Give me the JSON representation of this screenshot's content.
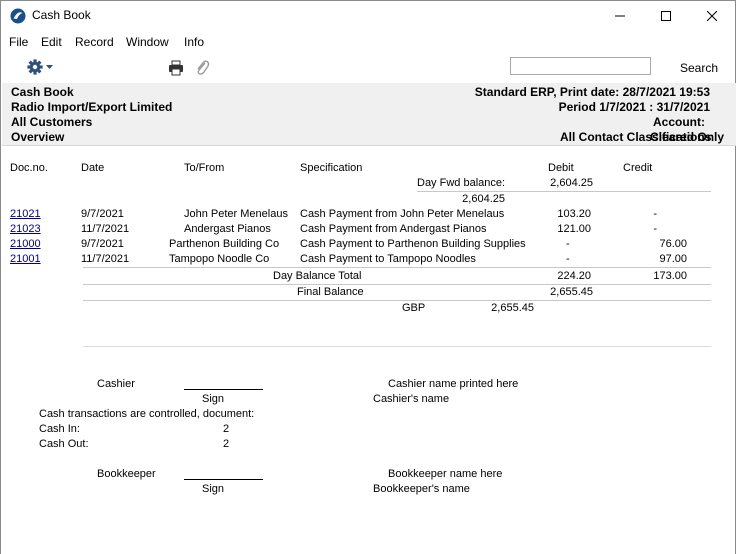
{
  "window": {
    "title": "Cash Book"
  },
  "menu": [
    "File",
    "Edit",
    "Record",
    "Window",
    "Info"
  ],
  "toolbar": {
    "search_value": "",
    "search_label": "Search"
  },
  "header": {
    "report_name": "Cash Book",
    "company": "Radio Import/Export Limited",
    "customers": "All Customers",
    "mode": "Overview",
    "print_info": "Standard ERP, Print date: 28/7/2021 19:53",
    "period": "Period  1/7/2021 : 31/7/2021",
    "account": "Account:",
    "contact_classes": "All Contact Classifications",
    "cleared": "Cleared Only"
  },
  "columns": {
    "docno": "Doc.no.",
    "date": "Date",
    "tofrom": "To/From",
    "spec": "Specification",
    "debit": "Debit",
    "credit": "Credit"
  },
  "day_fwd": {
    "label": "Day Fwd balance:",
    "value": "2,604.25",
    "value2": "2,604.25"
  },
  "rows": [
    {
      "docno": "21021",
      "date": "9/7/2021",
      "tofrom": "John Peter Menelaus",
      "spec": "Cash Payment from John Peter Menelaus",
      "debit": "103.20",
      "credit": "-"
    },
    {
      "docno": "21023",
      "date": "11/7/2021",
      "tofrom": "Andergast Pianos",
      "spec": "Cash Payment from Andergast Pianos",
      "debit": "121.00",
      "credit": "-"
    },
    {
      "docno": "21000",
      "date": "9/7/2021",
      "tofrom": "Parthenon Building Co",
      "spec": "Cash Payment to Parthenon Building Supplies",
      "debit": "-",
      "credit": "76.00"
    },
    {
      "docno": "21001",
      "date": "11/7/2021",
      "tofrom": "Tampopo Noodle Co",
      "spec": "Cash Payment to Tampopo Noodles",
      "debit": "-",
      "credit": "97.00"
    }
  ],
  "totals": {
    "day_label": "Day Balance Total",
    "day_debit": "224.20",
    "day_credit": "173.00",
    "final_label": "Final Balance",
    "final_value": "2,655.45",
    "currency": "GBP",
    "currency_value": "2,655.45"
  },
  "signatures": {
    "cashier": "Cashier",
    "sign1": "Sign",
    "cashier_name_here": "Cashier name printed here",
    "cashier_name": "Cashier's name",
    "controlled": "Cash transactions are controlled, document:",
    "cash_in_label": "Cash In:",
    "cash_in_value": "2",
    "cash_out_label": "Cash Out:",
    "cash_out_value": "2",
    "bookkeeper": "Bookkeeper",
    "sign2": "Sign",
    "bookkeeper_name_here": "Bookkeeper name here",
    "bookkeeper_name": "Bookkeeper's name"
  }
}
